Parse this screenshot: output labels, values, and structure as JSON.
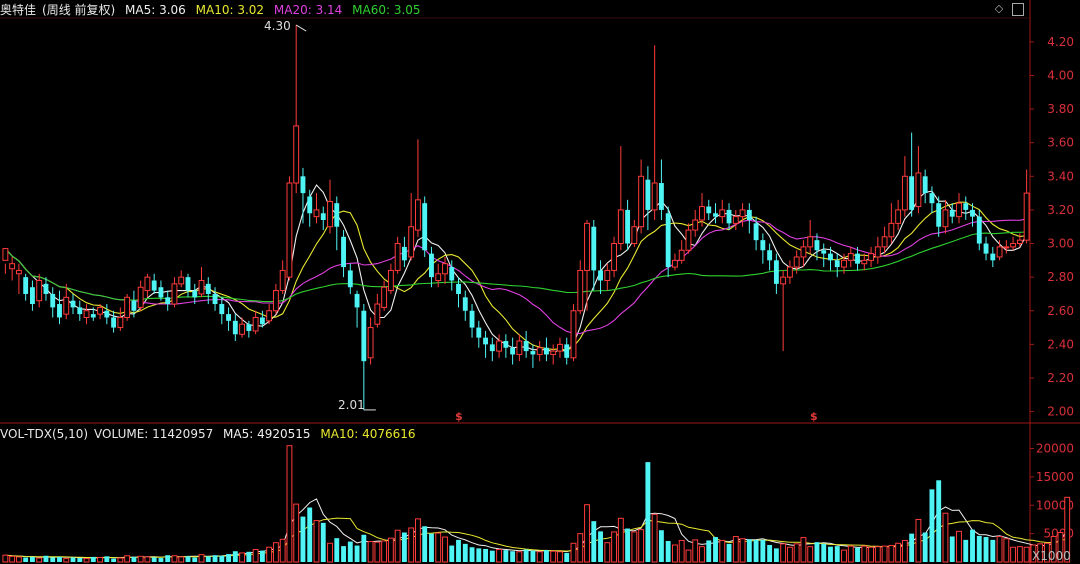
{
  "header": {
    "stock_name": "奥特佳",
    "period_mode": "(周线 前复权)",
    "ma5": "MA5: 3.06",
    "ma10": "MA10: 3.02",
    "ma20": "MA20: 3.14",
    "ma60": "MA60: 3.05"
  },
  "colors": {
    "up": "#ff3b3b",
    "down": "#4ff5f5",
    "ma5": "#f0f0f0",
    "ma10": "#e8e830",
    "ma20": "#e040e0",
    "ma60": "#30d030",
    "axis": "#a01818",
    "axis_text": "#d8303a"
  },
  "controls": {
    "diamond_icon": "◇",
    "window_icon": "▯"
  },
  "volume_header": {
    "indicator": "VOL-TDX(5,10)",
    "volume": "VOLUME: 11420957",
    "ma5": "MA5: 4920515",
    "ma10": "MA10: 4076616"
  },
  "annotations": {
    "high": "4.30",
    "low": "2.01",
    "marker1": "$",
    "marker2": "$"
  },
  "volume_unit": "X1000",
  "chart_data": [
    {
      "type": "candlestick",
      "title": "奥特佳",
      "y_ticks": [
        "4.20",
        "4.00",
        "3.80",
        "3.60",
        "3.40",
        "3.20",
        "3.00",
        "2.80",
        "2.60",
        "2.40",
        "2.20",
        "2.00"
      ],
      "ylim": [
        1.95,
        4.33
      ],
      "candles": [
        [
          2.9,
          2.97,
          2.88,
          2.82
        ],
        [
          2.85,
          2.88,
          2.92,
          2.78
        ],
        [
          2.82,
          2.84,
          2.88,
          2.7
        ],
        [
          2.8,
          2.7,
          2.82,
          2.66
        ],
        [
          2.74,
          2.64,
          2.78,
          2.6
        ],
        [
          2.66,
          2.78,
          2.82,
          2.62
        ],
        [
          2.76,
          2.7,
          2.8,
          2.66
        ],
        [
          2.7,
          2.62,
          2.74,
          2.56
        ],
        [
          2.64,
          2.56,
          2.72,
          2.52
        ],
        [
          2.58,
          2.68,
          2.76,
          2.55
        ],
        [
          2.66,
          2.62,
          2.7,
          2.58
        ],
        [
          2.62,
          2.58,
          2.66,
          2.54
        ],
        [
          2.56,
          2.6,
          2.64,
          2.52
        ],
        [
          2.58,
          2.56,
          2.62,
          2.54
        ],
        [
          2.58,
          2.62,
          2.64,
          2.55
        ],
        [
          2.6,
          2.56,
          2.64,
          2.52
        ],
        [
          2.56,
          2.5,
          2.6,
          2.47
        ],
        [
          2.5,
          2.56,
          2.62,
          2.48
        ],
        [
          2.56,
          2.68,
          2.7,
          2.54
        ],
        [
          2.66,
          2.6,
          2.72,
          2.56
        ],
        [
          2.62,
          2.74,
          2.78,
          2.6
        ],
        [
          2.72,
          2.8,
          2.82,
          2.68
        ],
        [
          2.78,
          2.72,
          2.82,
          2.7
        ],
        [
          2.74,
          2.68,
          2.78,
          2.66
        ],
        [
          2.68,
          2.64,
          2.72,
          2.6
        ],
        [
          2.64,
          2.76,
          2.8,
          2.62
        ],
        [
          2.76,
          2.8,
          2.84,
          2.74
        ],
        [
          2.8,
          2.72,
          2.82,
          2.68
        ],
        [
          2.72,
          2.68,
          2.76,
          2.64
        ],
        [
          2.7,
          2.78,
          2.86,
          2.68
        ],
        [
          2.76,
          2.7,
          2.8,
          2.64
        ],
        [
          2.7,
          2.64,
          2.74,
          2.6
        ],
        [
          2.64,
          2.58,
          2.68,
          2.52
        ],
        [
          2.58,
          2.54,
          2.62,
          2.48
        ],
        [
          2.54,
          2.46,
          2.58,
          2.42
        ],
        [
          2.46,
          2.52,
          2.56,
          2.44
        ],
        [
          2.52,
          2.48,
          2.54,
          2.44
        ],
        [
          2.48,
          2.56,
          2.6,
          2.46
        ],
        [
          2.56,
          2.52,
          2.6,
          2.5
        ],
        [
          2.54,
          2.6,
          2.64,
          2.52
        ],
        [
          2.6,
          2.72,
          2.76,
          2.58
        ],
        [
          2.72,
          2.84,
          2.9,
          2.7
        ],
        [
          2.8,
          3.36,
          3.4,
          2.78
        ],
        [
          3.36,
          3.7,
          4.3,
          3.3
        ],
        [
          3.4,
          3.3,
          3.45,
          3.12
        ],
        [
          3.28,
          3.18,
          3.32,
          3.1
        ],
        [
          3.16,
          3.2,
          3.3,
          3.12
        ],
        [
          3.18,
          3.14,
          3.22,
          3.08
        ],
        [
          3.1,
          3.25,
          3.38,
          3.06
        ],
        [
          3.24,
          3.1,
          3.28,
          2.96
        ],
        [
          3.04,
          2.86,
          3.08,
          2.8
        ],
        [
          2.84,
          2.74,
          2.88,
          2.7
        ],
        [
          2.7,
          2.62,
          2.72,
          2.5
        ],
        [
          2.6,
          2.3,
          2.64,
          2.01
        ],
        [
          2.32,
          2.5,
          2.56,
          2.28
        ],
        [
          2.52,
          2.64,
          2.7,
          2.5
        ],
        [
          2.62,
          2.74,
          2.78,
          2.6
        ],
        [
          2.72,
          2.84,
          2.88,
          2.7
        ],
        [
          2.84,
          3.0,
          3.04,
          2.82
        ],
        [
          2.98,
          2.9,
          3.04,
          2.86
        ],
        [
          2.92,
          3.1,
          3.3,
          2.9
        ],
        [
          3.08,
          3.26,
          3.62,
          3.04
        ],
        [
          3.24,
          2.96,
          3.28,
          2.92
        ],
        [
          2.94,
          2.8,
          2.98,
          2.74
        ],
        [
          2.78,
          2.82,
          2.88,
          2.74
        ],
        [
          2.82,
          2.88,
          2.92,
          2.76
        ],
        [
          2.86,
          2.78,
          2.9,
          2.72
        ],
        [
          2.76,
          2.7,
          2.8,
          2.62
        ],
        [
          2.68,
          2.6,
          2.72,
          2.54
        ],
        [
          2.6,
          2.5,
          2.64,
          2.44
        ],
        [
          2.5,
          2.44,
          2.54,
          2.38
        ],
        [
          2.44,
          2.4,
          2.48,
          2.32
        ],
        [
          2.4,
          2.36,
          2.44,
          2.3
        ],
        [
          2.36,
          2.42,
          2.46,
          2.32
        ],
        [
          2.42,
          2.38,
          2.46,
          2.32
        ],
        [
          2.38,
          2.34,
          2.44,
          2.28
        ],
        [
          2.34,
          2.42,
          2.46,
          2.3
        ],
        [
          2.42,
          2.36,
          2.48,
          2.32
        ],
        [
          2.36,
          2.34,
          2.4,
          2.26
        ],
        [
          2.34,
          2.38,
          2.42,
          2.3
        ],
        [
          2.38,
          2.34,
          2.44,
          2.3
        ],
        [
          2.34,
          2.36,
          2.4,
          2.28
        ],
        [
          2.36,
          2.4,
          2.44,
          2.32
        ],
        [
          2.4,
          2.32,
          2.44,
          2.28
        ],
        [
          2.32,
          2.6,
          2.64,
          2.3
        ],
        [
          2.6,
          2.84,
          2.9,
          2.58
        ],
        [
          2.84,
          3.12,
          3.14,
          2.6
        ],
        [
          3.1,
          2.84,
          3.14,
          2.72
        ],
        [
          2.84,
          2.78,
          2.9,
          2.7
        ],
        [
          2.78,
          2.84,
          2.88,
          2.72
        ],
        [
          2.84,
          3.0,
          3.04,
          2.8
        ],
        [
          3.0,
          3.2,
          3.58,
          2.96
        ],
        [
          3.2,
          3.0,
          3.26,
          2.96
        ],
        [
          3.0,
          3.1,
          3.14,
          2.98
        ],
        [
          3.1,
          3.4,
          3.5,
          3.06
        ],
        [
          3.38,
          3.2,
          3.46,
          3.08
        ],
        [
          3.2,
          3.36,
          4.18,
          3.14
        ],
        [
          3.36,
          3.2,
          3.5,
          3.14
        ],
        [
          3.18,
          2.86,
          3.22,
          2.8
        ],
        [
          2.86,
          2.9,
          2.94,
          2.84
        ],
        [
          2.9,
          2.96,
          3.02,
          2.88
        ],
        [
          2.96,
          3.08,
          3.12,
          2.94
        ],
        [
          3.08,
          3.14,
          3.2,
          3.04
        ],
        [
          3.14,
          3.22,
          3.3,
          3.1
        ],
        [
          3.22,
          3.18,
          3.26,
          3.14
        ],
        [
          3.18,
          3.16,
          3.24,
          3.12
        ],
        [
          3.16,
          3.2,
          3.26,
          3.12
        ],
        [
          3.2,
          3.12,
          3.24,
          3.08
        ],
        [
          3.12,
          3.16,
          3.2,
          3.08
        ],
        [
          3.16,
          3.2,
          3.24,
          3.1
        ],
        [
          3.2,
          3.14,
          3.24,
          3.06
        ],
        [
          3.12,
          3.02,
          3.16,
          2.96
        ],
        [
          3.02,
          2.96,
          3.06,
          2.88
        ],
        [
          2.96,
          2.9,
          3.0,
          2.84
        ],
        [
          2.9,
          2.76,
          2.94,
          2.7
        ],
        [
          2.76,
          2.8,
          2.84,
          2.36
        ],
        [
          2.8,
          2.86,
          2.9,
          2.76
        ],
        [
          2.86,
          2.92,
          2.96,
          2.82
        ],
        [
          2.92,
          2.98,
          3.02,
          2.86
        ],
        [
          2.98,
          3.04,
          3.14,
          2.94
        ],
        [
          3.02,
          2.96,
          3.06,
          2.9
        ],
        [
          2.96,
          2.94,
          3.0,
          2.86
        ],
        [
          2.94,
          2.9,
          2.98,
          2.84
        ],
        [
          2.9,
          2.86,
          2.94,
          2.8
        ],
        [
          2.86,
          2.9,
          2.94,
          2.82
        ],
        [
          2.9,
          2.94,
          2.98,
          2.86
        ],
        [
          2.94,
          2.88,
          2.98,
          2.84
        ],
        [
          2.88,
          2.9,
          2.94,
          2.84
        ],
        [
          2.9,
          2.94,
          2.98,
          2.86
        ],
        [
          2.92,
          2.98,
          3.04,
          2.88
        ],
        [
          2.98,
          3.04,
          3.1,
          2.94
        ],
        [
          3.04,
          3.12,
          3.24,
          3.0
        ],
        [
          3.12,
          3.2,
          3.26,
          3.08
        ],
        [
          3.2,
          3.4,
          3.52,
          3.16
        ],
        [
          3.4,
          3.2,
          3.66,
          3.16
        ],
        [
          3.22,
          3.42,
          3.58,
          3.18
        ],
        [
          3.4,
          3.3,
          3.44,
          3.24
        ],
        [
          3.3,
          3.24,
          3.34,
          3.18
        ],
        [
          3.24,
          3.1,
          3.28,
          3.04
        ],
        [
          3.1,
          3.2,
          3.26,
          3.06
        ],
        [
          3.2,
          3.16,
          3.24,
          3.12
        ],
        [
          3.16,
          3.24,
          3.3,
          3.12
        ],
        [
          3.24,
          3.2,
          3.28,
          3.14
        ],
        [
          3.2,
          3.16,
          3.24,
          3.1
        ],
        [
          3.16,
          3.0,
          3.2,
          2.96
        ],
        [
          3.0,
          2.94,
          3.04,
          2.9
        ],
        [
          2.94,
          2.9,
          2.98,
          2.86
        ],
        [
          2.92,
          2.98,
          3.02,
          2.9
        ],
        [
          2.98,
          2.98,
          3.02,
          2.94
        ],
        [
          2.98,
          3.0,
          3.04,
          2.96
        ],
        [
          3.0,
          3.02,
          3.06,
          2.98
        ],
        [
          3.02,
          3.3,
          3.44,
          3.0
        ]
      ]
    },
    {
      "type": "bar",
      "title": "VOL-TDX(5,10)",
      "y_ticks": [
        "20000",
        "15000",
        "10000",
        "5000"
      ],
      "ylim": [
        0,
        21500
      ],
      "volumes": [
        1200,
        1000,
        900,
        800,
        900,
        700,
        1100,
        800,
        900,
        600,
        800,
        700,
        600,
        900,
        800,
        1000,
        600,
        700,
        1100,
        900,
        1000,
        900,
        800,
        700,
        1200,
        1100,
        900,
        1000,
        800,
        1300,
        1000,
        1200,
        1100,
        1400,
        1900,
        1600,
        1800,
        2200,
        2000,
        2600,
        3400,
        4000,
        20500,
        10200,
        8000,
        9600,
        7300,
        6900,
        3300,
        4200,
        2800,
        3600,
        2900,
        4800,
        3600,
        3500,
        3700,
        4200,
        5600,
        5200,
        6000,
        7600,
        6300,
        5000,
        5100,
        4400,
        2900,
        3900,
        3200,
        2600,
        2400,
        2300,
        2000,
        2200,
        2100,
        1900,
        1800,
        2200,
        2000,
        1800,
        2100,
        1900,
        1800,
        1600,
        3300,
        5000,
        10100,
        7200,
        5400,
        3400,
        5300,
        7700,
        5900,
        5300,
        5700,
        17600,
        8400,
        5600,
        3700,
        3000,
        3800,
        2100,
        3900,
        2700,
        3800,
        4400,
        3800,
        3200,
        4500,
        4100,
        4000,
        3900,
        3900,
        3000,
        2400,
        3200,
        2600,
        3200,
        4300,
        2700,
        3500,
        3200,
        2700,
        2800,
        2100,
        2800,
        2500,
        2800,
        2600,
        2700,
        2800,
        2900,
        3300,
        3800,
        5000,
        7500,
        5200,
        12800,
        14400,
        8600,
        4500,
        5400,
        3900,
        5700,
        4600,
        4400,
        3900,
        4500,
        4100,
        2600,
        2700,
        2600,
        3000,
        3200,
        3300,
        4500,
        5200,
        11400
      ]
    }
  ]
}
